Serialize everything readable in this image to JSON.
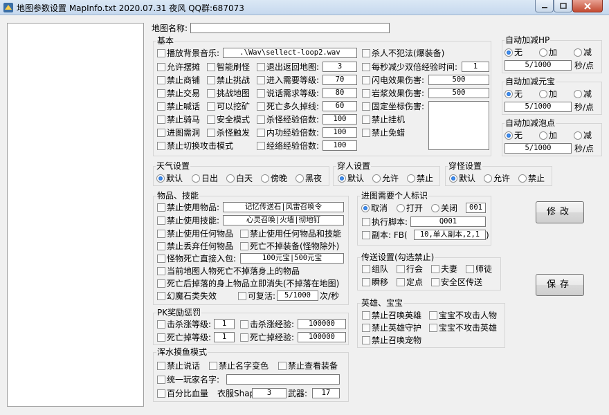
{
  "title": "地图参数设置 MapInfo.txt   2020.07.31          夜风  QQ群:687073",
  "icons": {
    "app": "app-icon",
    "minimize": "minimize-icon",
    "maximize": "maximize-icon",
    "close": "close-icon"
  },
  "colors": {
    "titlebar": "#c5d8ee",
    "radio_dot": "#0b4fb8",
    "close": "#c34a31"
  },
  "map_name": {
    "label": "地图名称:",
    "value": ""
  },
  "basic": {
    "title": "基本",
    "bgm_label": "播放背景音乐:",
    "bgm_value": ".\\Wav\\sellect-loop2.wav",
    "no_kill": "杀人不犯法(爆装备)",
    "allow_stall": "允许摆摊",
    "smart_refresh": "智能刷怪",
    "exit_map_label": "退出返回地图:",
    "exit_map_value": "3",
    "double_exp_label": "每秒减少双倍经验时间:",
    "double_exp_value": "1",
    "no_shop": "禁止商铺",
    "no_challenge": "禁止挑战",
    "enter_level_label": "进入需要等级:",
    "enter_level_value": "70",
    "flash_label": "闪电效果伤害:",
    "flash_value": "500",
    "no_trade": "禁止交易",
    "challenge_map": "挑战地图",
    "talk_level_label": "说话需求等级:",
    "talk_level_value": "80",
    "lava_label": "岩浆效果伤害:",
    "lava_value": "500",
    "no_shout": "禁止喊话",
    "can_mine": "可以挖矿",
    "death_drop_label": "死亡多久掉线:",
    "death_drop_value": "60",
    "fixed_dmg": "固定坐标伤害:",
    "no_ride": "禁止骑马",
    "safe_mode": "安全模式",
    "kill_exp_label": "杀怪经验倍数:",
    "kill_exp_value": "100",
    "no_hangup": "禁止挂机",
    "need_hole": "进图需洞",
    "kill_trigger": "杀怪触发",
    "inner_exp_label": "内功经验倍数:",
    "inner_exp_value": "100",
    "no_avoid": "禁止免蜡",
    "no_switch_attack": "禁止切换攻击模式",
    "meridian_exp_label": "经络经验倍数:",
    "meridian_exp_value": "100"
  },
  "auto_hp": {
    "title": "自动加减HP",
    "r_none": "无",
    "r_add": "加",
    "r_sub": "减",
    "value": "5/1000",
    "unit": "秒/点"
  },
  "auto_gold": {
    "title": "自动加减元宝",
    "r_none": "无",
    "r_add": "加",
    "r_sub": "减",
    "value": "5/1000",
    "unit": "秒/点"
  },
  "auto_bubble": {
    "title": "自动加减泡点",
    "r_none": "无",
    "r_add": "加",
    "r_sub": "减",
    "value": "5/1000",
    "unit": "秒/点"
  },
  "weather": {
    "title": "天气设置",
    "default": "默认",
    "sunrise": "日出",
    "day": "白天",
    "dusk": "傍晚",
    "night": "黑夜"
  },
  "person": {
    "title": "穿人设置",
    "default": "默认",
    "allow": "允许",
    "forbid": "禁止"
  },
  "monster": {
    "title": "穿怪设置",
    "default": "默认",
    "allow": "允许",
    "forbid": "禁止"
  },
  "items": {
    "title": "物品、技能",
    "no_use_item_label": "禁止使用物品:",
    "no_use_item_value": "记忆传送石|风雷召唤令",
    "no_use_skill_label": "禁止使用技能:",
    "no_use_skill_value": "心灵召唤|火墙|彻地钉",
    "no_any_item": "禁止使用任何物品",
    "no_any_item_skill": "禁止使用任何物品和技能",
    "no_drop_item": "禁止丢弃任何物品",
    "no_death_drop": "死亡不掉装备(怪物除外)",
    "monster_bag_label": "怪物死亡直接入包:",
    "monster_bag_value": "100元宝|500元宝",
    "no_drop_body": "当前地图人物死亡不掉落身上的物品",
    "vanish": "死亡后掉落的身上物品立即消失(不掉落在地图)",
    "fantasy_stone": "幻魔石类失效",
    "revive_label": "可复活:",
    "revive_value": "5/1000",
    "revive_unit": "次/秒"
  },
  "pk": {
    "title": "PK奖励惩罚",
    "kill_level_label": "击杀涨等级:",
    "kill_level_value": "1",
    "kill_exp_label": "击杀涨经验:",
    "kill_exp_value": "100000",
    "death_level_label": "死亡掉等级:",
    "death_level_value": "1",
    "death_exp_label": "死亡掉经验:",
    "death_exp_value": "100000"
  },
  "fishing": {
    "title": "浑水摸鱼模式",
    "no_talk": "禁止说话",
    "no_name_color": "禁止名字变色",
    "no_view_equip": "禁止查看装备",
    "unify_name_label": "统一玩家名字:",
    "unify_name_value": "",
    "percent_hp": "百分比血量",
    "shape_label": "衣服Shape:",
    "shape_value": "3",
    "weapon_label": "武器:",
    "weapon_value": "17"
  },
  "enter_flag": {
    "title": "进图需要个人标识",
    "cancel": "取消",
    "open": "打开",
    "close": "关闭",
    "flag_value": "001",
    "run_script_label": "执行脚本:",
    "run_script_value": "Q001",
    "copy_label": "副本: FB(",
    "copy_value": "10,单人副本,2,1",
    "copy_suffix": ")"
  },
  "teleport": {
    "title": "传送设置(勾选禁止)",
    "group": "组队",
    "guild": "行会",
    "couple": "夫妻",
    "master": "师徒",
    "instant": "瞬移",
    "fixed": "定点",
    "safe_zone": "安全区传送"
  },
  "hero": {
    "title": "英雄、宝宝",
    "no_summon_hero": "禁止召唤英雄",
    "pet_no_attack_human": "宝宝不攻击人物",
    "no_hero_guard": "禁止英雄守护",
    "pet_no_attack_hero": "宝宝不攻击英雄",
    "no_summon_pet": "禁止召唤宠物"
  },
  "buttons": {
    "modify": "修改",
    "save": "保存"
  }
}
